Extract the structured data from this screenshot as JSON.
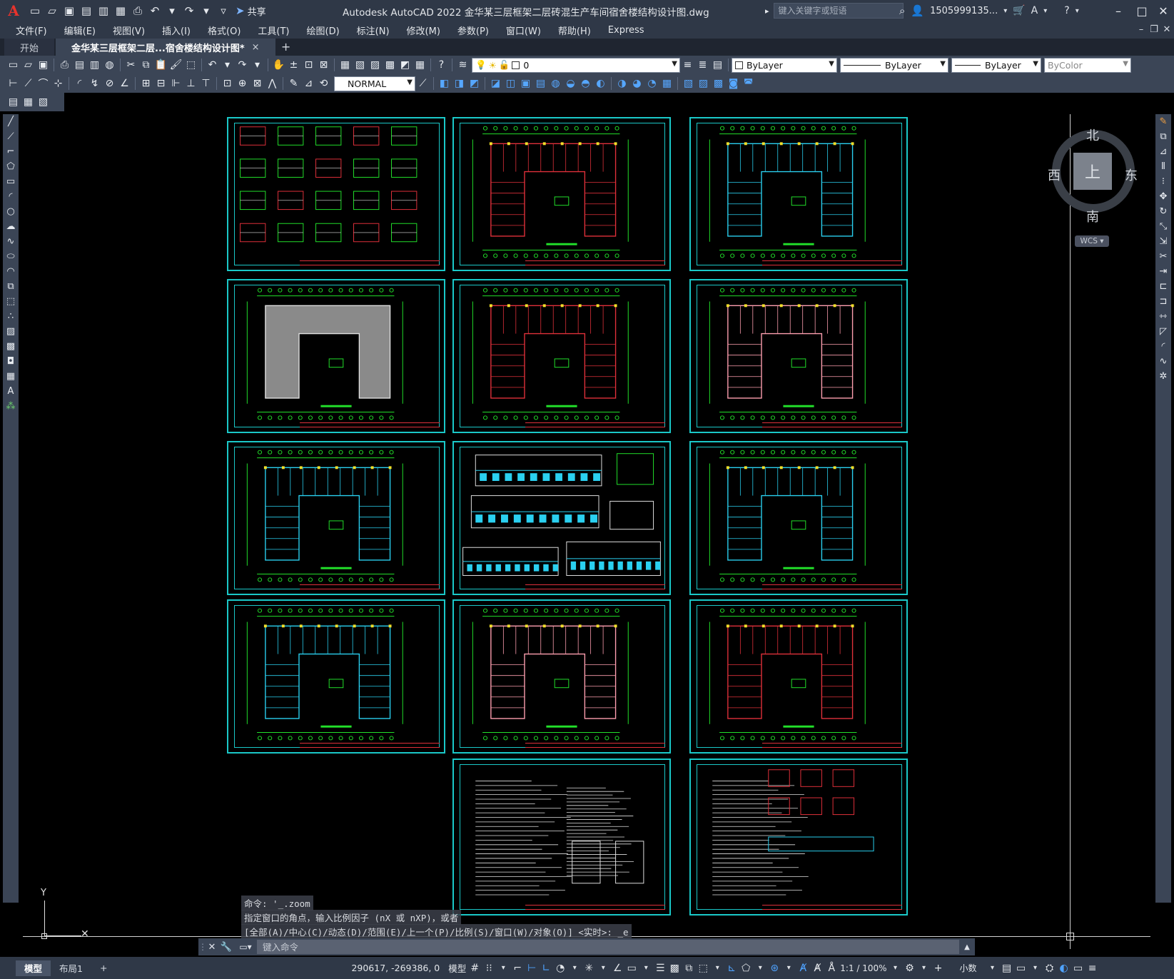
{
  "app": {
    "logo_letter": "A",
    "window_title": "Autodesk AutoCAD 2022    金华某三层框架二层砖混生产车间宿舍楼结构设计图.dwg",
    "share_label": "共享",
    "search_placeholder": "键入关键字或短语",
    "user_name": "1505999135...",
    "accent_color": "#1ac8c8"
  },
  "menu": [
    "文件(F)",
    "编辑(E)",
    "视图(V)",
    "插入(I)",
    "格式(O)",
    "工具(T)",
    "绘图(D)",
    "标注(N)",
    "修改(M)",
    "参数(P)",
    "窗口(W)",
    "帮助(H)",
    "Express"
  ],
  "tabs": {
    "start_label": "开始",
    "drawing_label": "金华某三层框架二层...宿舍楼结构设计图*",
    "close_glyph": "×",
    "add_glyph": "+"
  },
  "toolbar": {
    "layer_value": "0",
    "color_value": "ByLayer",
    "linetype_value": "ByLayer",
    "lineweight_value": "ByLayer",
    "plotstyle_value": "ByColor",
    "dimstyle_value": "NORMAL"
  },
  "viewcube": {
    "north": "北",
    "south": "南",
    "east": "东",
    "west": "西",
    "face": "上",
    "wcs": "WCS"
  },
  "ucs": {
    "y_label": "Y"
  },
  "command": {
    "history": [
      "命令: '_.zoom",
      "指定窗口的角点，输入比例因子 (nX 或 nXP)，或者",
      "[全部(A)/中心(C)/动态(D)/范围(E)/上一个(P)/比例(S)/窗口(W)/对象(O)] <实时>: _e"
    ],
    "placeholder": "键入命令"
  },
  "status": {
    "model_tab": "模型",
    "layout_tab": "布局1",
    "add_tab": "+",
    "coordinates": "290617, -269386, 0",
    "model_label": "模型",
    "scale": "1:1 / 100%",
    "units": "小数"
  },
  "colors": {
    "sheet_border": "#1ac8c8",
    "title_block": "#e0303a",
    "plan_lines": "#22e02a",
    "beam_red": "#e0303a",
    "column_yellow": "#f2e02a",
    "magenta_tag": "#e040e0"
  }
}
